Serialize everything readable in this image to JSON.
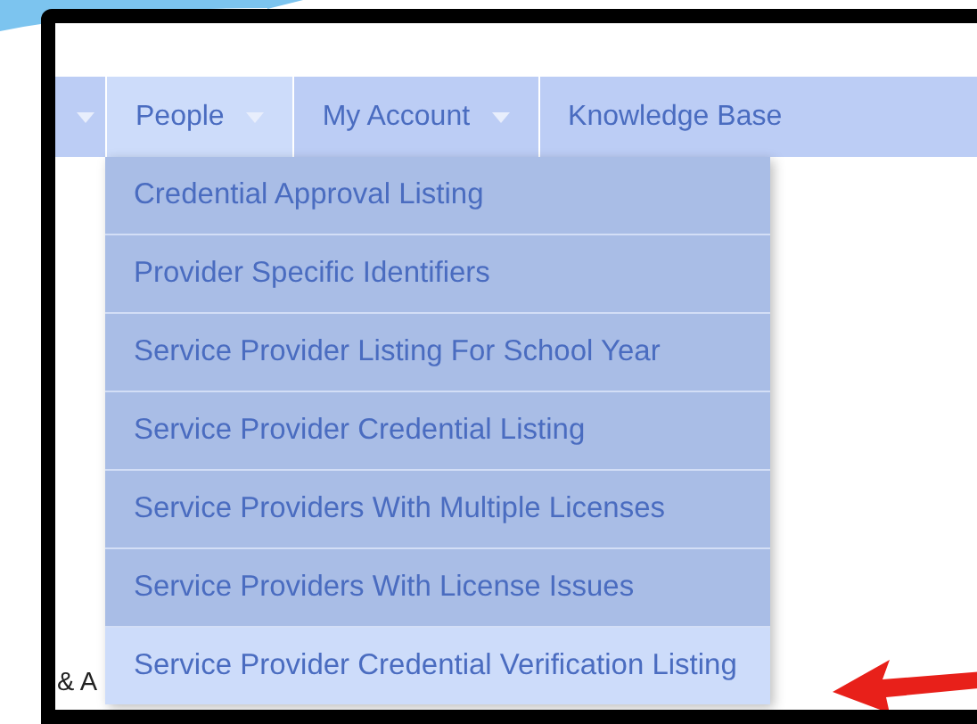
{
  "nav": [
    {
      "has_caret": true,
      "selected": false
    },
    {
      "label": "People",
      "has_caret": true,
      "selected": true
    },
    {
      "label": "My Account",
      "has_caret": true,
      "selected": false
    },
    {
      "label": "Knowledge Base",
      "has_caret": false,
      "selected": false
    }
  ],
  "menu": [
    {
      "label": "Credential Approval Listing",
      "selected": false
    },
    {
      "label": "Provider Specific Identifiers",
      "selected": false
    },
    {
      "label": "Service Provider Listing For School Year",
      "selected": false
    },
    {
      "label": "Service Provider Credential Listing",
      "selected": false
    },
    {
      "label": "Service Providers With Multiple Licenses",
      "selected": false
    },
    {
      "label": "Service Providers With License Issues",
      "selected": false
    },
    {
      "label": "Service Provider Credential Verification Listing",
      "selected": true
    }
  ],
  "page_text": "& A"
}
